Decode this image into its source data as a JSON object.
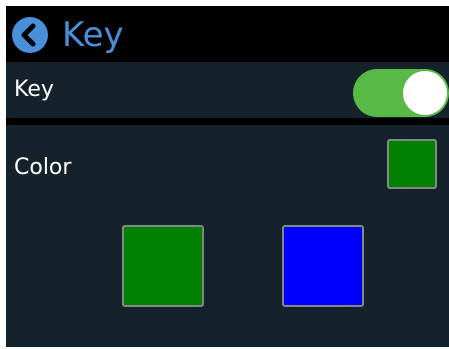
{
  "header": {
    "back_icon": "chevron-left-icon",
    "title": "Key"
  },
  "key_row": {
    "label": "Key",
    "toggle_on": true,
    "toggle_color": "#59b947"
  },
  "color_row": {
    "label": "Color",
    "current_color": "#008000"
  },
  "color_options": [
    {
      "name": "green",
      "color": "#008000"
    },
    {
      "name": "blue",
      "color": "#0000ff"
    }
  ],
  "theme": {
    "accent": "#4a8fd9",
    "panel": "#16222b",
    "background": "#000000"
  }
}
